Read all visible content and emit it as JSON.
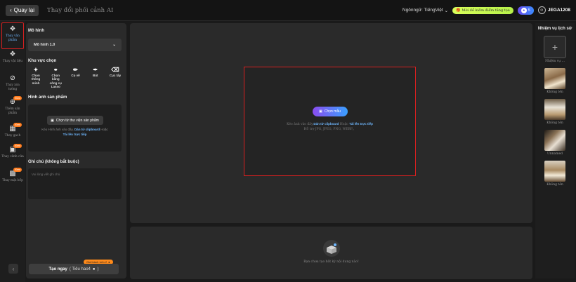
{
  "topbar": {
    "back_label": "Quay lại",
    "title": "Thay đổi phối cảnh AI",
    "language_label": "Ngônngữ: TiếngViệt",
    "promo_label": "Mời để kiếm điểm tăng tọa",
    "credits_value": "5",
    "username": "JEGA1208"
  },
  "leftnav": {
    "items": [
      {
        "label": "Thay vân phẩm",
        "icon": "product-swap-icon",
        "active": true,
        "new": false
      },
      {
        "label": "Thay vật liệu",
        "icon": "material-swap-icon",
        "active": false,
        "new": false
      },
      {
        "label": "Thay xóa tường",
        "icon": "erase-icon",
        "active": false,
        "new": false
      },
      {
        "label": "Thêm sản phẩm",
        "icon": "add-product-icon",
        "active": false,
        "new": true
      },
      {
        "label": "Thay gạch",
        "icon": "tile-icon",
        "active": false,
        "new": true
      },
      {
        "label": "Thay cảnh cửa",
        "icon": "door-icon",
        "active": false,
        "new": true
      },
      {
        "label": "Thay mặt bếp",
        "icon": "kitchen-icon",
        "active": false,
        "new": true
      }
    ],
    "new_tag": "New"
  },
  "panel": {
    "model_title": "Mô hình",
    "model_value": "Mô hình 1.0",
    "area_title": "Khu vực chọn",
    "tools": [
      {
        "label": "Chọn thông minh",
        "icon": "smart-select-icon"
      },
      {
        "label": "Chọn bằng công cụ Lasso",
        "icon": "lasso-icon"
      },
      {
        "label": "Cọ vẽ",
        "icon": "brush-icon"
      },
      {
        "label": "Bút",
        "icon": "pen-icon"
      },
      {
        "label": "Cục tẩy",
        "icon": "eraser-icon"
      }
    ],
    "product_image_title": "Hình ảnh sản phẩm",
    "upload_button": "Chọn từ thư viện sản phẩm",
    "upload_hint_prefix": "Kéo Hình ảnh vào đây,",
    "upload_hint_clipboard": "Dán từ clipboard",
    "upload_hint_or": "Hoặc",
    "upload_hint_direct": "Tải lên trực tiếp",
    "note_title": "Ghi chú (không bắt buộc)",
    "note_placeholder": "Vui lòng viết ghi chú",
    "generate_label": "Tạo ngay",
    "generate_sub": "( Tiêu hao4",
    "generate_sub_end": ")",
    "discount_label": "Giá thành viên 2"
  },
  "canvas": {
    "choose_label": "Chọn mẫu",
    "hint_prefix": "Kéo ảnh vào đây,",
    "hint_clipboard": "Dán từ clipboard",
    "hint_or": "Hoặc",
    "hint_direct": "Tải lên trực tiếp",
    "formats": "Hỗ trợ JPG, JPEG, PNG, WEBP。"
  },
  "result": {
    "empty_text": "Bạn chưa tạo bất kỳ nội dung nào!"
  },
  "history": {
    "title": "Nhiệm vụ lịch sử",
    "new_task_label": "Nhiệm vụ ...",
    "items": [
      {
        "label": "Không tên"
      },
      {
        "label": "Không tên"
      },
      {
        "label": "Unnamed"
      },
      {
        "label": "Không tên"
      }
    ]
  },
  "colors": {
    "accent": "#6fb8ff",
    "highlight_border": "#d62020",
    "new_tag": "#ff7a1a"
  }
}
